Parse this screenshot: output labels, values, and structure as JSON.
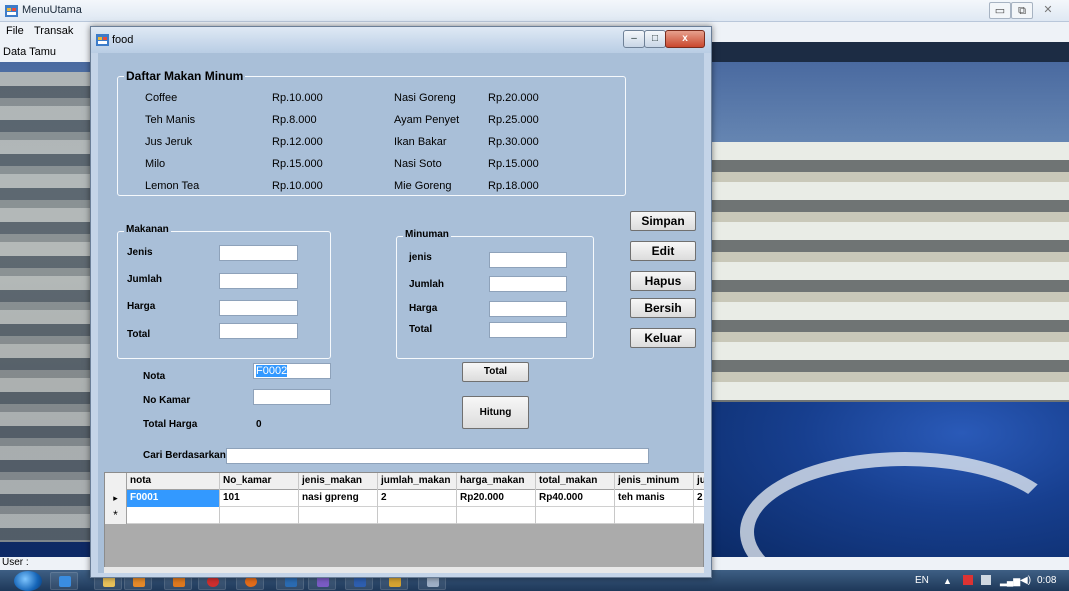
{
  "main_window": {
    "title": "MenuUtama",
    "menu": [
      "File",
      "Transak"
    ],
    "menu2": "Data Tamu",
    "status_label": "User :"
  },
  "child_window": {
    "title": "food",
    "controls": {
      "minimize": "–",
      "maximize": "□",
      "close": "x"
    }
  },
  "menu_group": {
    "title": "Daftar Makan Minum",
    "drinks": [
      {
        "name": "Coffee",
        "price": "Rp.10.000"
      },
      {
        "name": "Teh Manis",
        "price": "Rp.8.000"
      },
      {
        "name": "Jus Jeruk",
        "price": "Rp.12.000"
      },
      {
        "name": "Milo",
        "price": "Rp.15.000"
      },
      {
        "name": "Lemon Tea",
        "price": "Rp.10.000"
      }
    ],
    "foods": [
      {
        "name": "Nasi Goreng",
        "price": "Rp.20.000"
      },
      {
        "name": "Ayam Penyet",
        "price": "Rp.25.000"
      },
      {
        "name": "Ikan Bakar",
        "price": "Rp.30.000"
      },
      {
        "name": "Nasi Soto",
        "price": "Rp.15.000"
      },
      {
        "name": "Mie Goreng",
        "price": "Rp.18.000"
      }
    ]
  },
  "makanan": {
    "title": "Makanan",
    "labels": [
      "Jenis",
      "Jumlah",
      "Harga",
      "Total"
    ],
    "values": [
      "",
      "",
      "",
      ""
    ]
  },
  "minuman": {
    "title": "Minuman",
    "labels": [
      "jenis",
      "Jumlah",
      "Harga",
      "Total"
    ],
    "values": [
      "",
      "",
      "",
      ""
    ]
  },
  "actions": {
    "simpan": "Simpan",
    "edit": "Edit",
    "hapus": "Hapus",
    "bersih": "Bersih",
    "keluar": "Keluar",
    "total": "Total",
    "hitung": "Hitung"
  },
  "order": {
    "nota_label": "Nota",
    "nota_value": "F0002",
    "kamar_label": "No Kamar",
    "kamar_value": "",
    "total_harga_label": "Total Harga",
    "total_harga_value": "0",
    "search_label": "Cari Berdasarkan",
    "search_value": ""
  },
  "grid": {
    "columns": [
      "nota",
      "No_kamar",
      "jenis_makan",
      "jumlah_makan",
      "harga_makan",
      "total_makan",
      "jenis_minum",
      "jum"
    ],
    "rows": [
      [
        "F0001",
        "101",
        "nasi gpreng",
        "2",
        "Rp20.000",
        "Rp40.000",
        "teh manis",
        "2"
      ]
    ],
    "current_row_marker": "▸",
    "new_row_marker": "*"
  },
  "taskbar": {
    "language": "EN",
    "clock": "0:08"
  },
  "colors": {
    "form_bg": "#a9bfd8",
    "selection": "#3399ff",
    "close_button": "#c9472d"
  }
}
